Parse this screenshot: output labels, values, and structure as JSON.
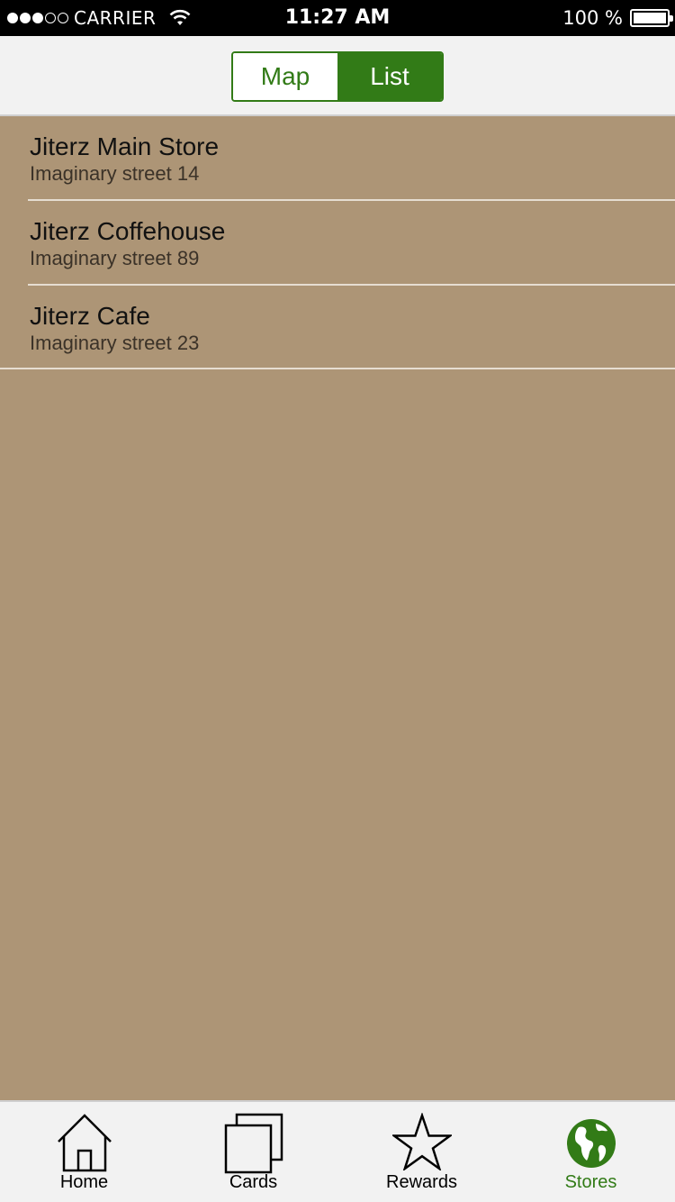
{
  "status_bar": {
    "carrier": "CARRIER",
    "time": "11:27 AM",
    "battery": "100 %",
    "signal_bars_filled": 3,
    "signal_bars_total": 5
  },
  "segmented_control": {
    "map_label": "Map",
    "list_label": "List",
    "selected": "List",
    "accent_color": "#327b17"
  },
  "stores": [
    {
      "name": "Jiterz Main Store",
      "address": "Imaginary street 14"
    },
    {
      "name": "Jiterz Coffehouse",
      "address": "Imaginary street 89"
    },
    {
      "name": "Jiterz Cafe",
      "address": "Imaginary street 23"
    }
  ],
  "tab_bar": {
    "tabs": [
      {
        "label": "Home",
        "icon": "home-icon"
      },
      {
        "label": "Cards",
        "icon": "cards-icon"
      },
      {
        "label": "Rewards",
        "icon": "star-icon"
      },
      {
        "label": "Stores",
        "icon": "globe-icon"
      }
    ],
    "active": "Stores"
  },
  "colors": {
    "background": "#ad9576",
    "accent": "#327b17"
  }
}
